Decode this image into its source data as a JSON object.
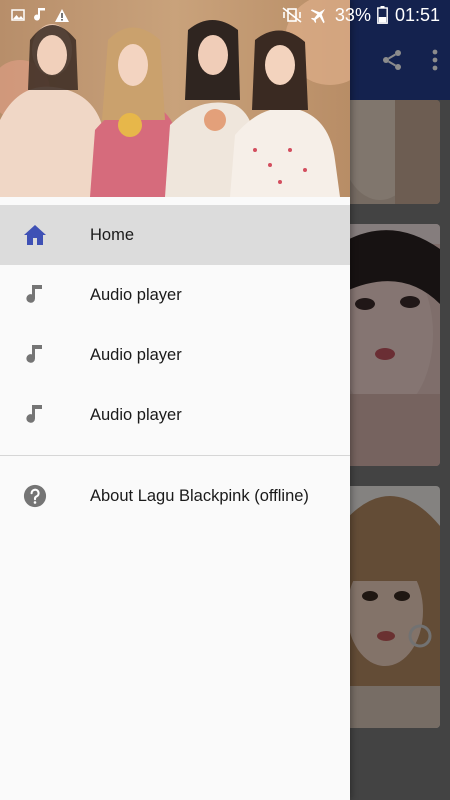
{
  "status_bar": {
    "left_icons": [
      "image-icon",
      "music-note-icon",
      "warning-icon"
    ],
    "right_icons": [
      "mute-vibrate-icon",
      "airplane-icon"
    ],
    "battery": "33%",
    "time": "01:51"
  },
  "toolbar": {
    "actions": [
      "share-icon",
      "overflow-menu-icon"
    ]
  },
  "drawer": {
    "menu": [
      {
        "label": "Home",
        "icon": "home-icon",
        "active": true
      },
      {
        "label": "Audio player",
        "icon": "music-note-icon",
        "active": false
      },
      {
        "label": "Audio player",
        "icon": "music-note-icon",
        "active": false
      },
      {
        "label": "Audio player",
        "icon": "music-note-icon",
        "active": false
      }
    ],
    "secondary": [
      {
        "label": "About Lagu Blackpink (offline)",
        "icon": "help-icon"
      }
    ]
  },
  "colors": {
    "toolbar": "#263f8f",
    "home_icon": "#3f51b5",
    "menu_icon": "#757575",
    "active_row": "#dcdcdc"
  }
}
